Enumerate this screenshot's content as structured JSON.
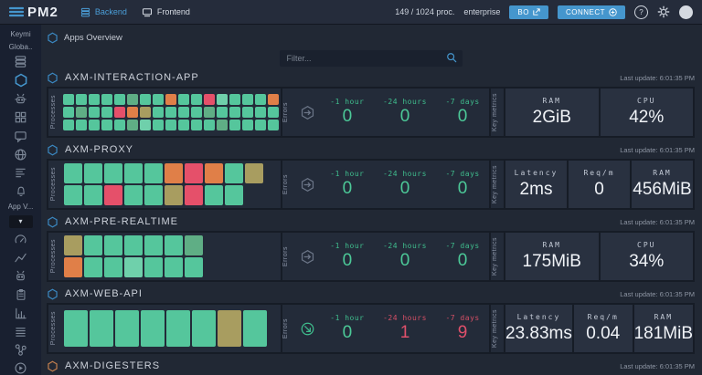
{
  "topbar": {
    "logo_text": "PM2",
    "tabs": [
      {
        "label": "Backend",
        "active": true
      },
      {
        "label": "Frontend",
        "active": false
      }
    ],
    "processes_count": "149 / 1024 proc.",
    "plan": "enterprise",
    "bo_button_label": "BO",
    "connect_button_label": "CONNECT",
    "accent_blue": "#4596cd"
  },
  "sidebar": {
    "keymetrics_label": "Keymi",
    "global_label": "Globa..",
    "app_label": "App V...",
    "icons": [
      "servers-icon",
      "hexagon-apps-icon",
      "robot-icon",
      "modules-grid-icon",
      "chat-icon",
      "globe-icon",
      "metrics-bars-icon",
      "bell-icon",
      "dashboard-gauge-icon",
      "line-chart-icon",
      "robot-profiling-icon",
      "report-clipboard-icon",
      "histogram-icon",
      "logs-list-icon",
      "dependencies-icon",
      "play-circle-icon"
    ]
  },
  "page": {
    "title": "Apps Overview",
    "filter_placeholder": "Filter..."
  },
  "labels": {
    "processes": "Processes",
    "errors": "Errors",
    "key_metrics": "Key metrics"
  },
  "colors": {
    "g": "#55c69c",
    "G": "#6fd0ab",
    "d": "#5fae85",
    "k": "#a89d60",
    "o": "#e07f48",
    "r": "#e5506a",
    "ok_green": "#45c392",
    "alert_red": "#d94f63",
    "hex_blue": "#3a87c0",
    "hex_orange": "#bf7e4e"
  },
  "apps": [
    {
      "name": "AXM-INTERACTION-APP",
      "last_update": "Last update: 6:01:35 PM",
      "hex_color": "#3a87c0",
      "errors_icon": "hexagon-arrow",
      "grid": {
        "cw": 12,
        "ch": 12,
        "rows": [
          "gggggdggoggrGgggo",
          "gdggrokggggdggggg",
          "gggggdGgggggdgggg"
        ]
      },
      "errors": [
        {
          "label": "-1 hour",
          "value": "0",
          "alert": false
        },
        {
          "label": "-24 hours",
          "value": "0",
          "alert": false
        },
        {
          "label": "-7 days",
          "value": "0",
          "alert": false
        }
      ],
      "metrics": [
        {
          "label": "RAM",
          "value": "2GiB"
        },
        {
          "label": "CPU",
          "value": "42%"
        }
      ]
    },
    {
      "name": "AXM-PROXY",
      "last_update": "Last update: 6:01:35 PM",
      "hex_color": "#3a87c0",
      "errors_icon": "hexagon-arrow",
      "grid": {
        "cw": 20,
        "ch": 22,
        "rows": [
          "gggggorogk",
          "ggrggkrgg"
        ]
      },
      "errors": [
        {
          "label": "-1 hour",
          "value": "0",
          "alert": false
        },
        {
          "label": "-24 hours",
          "value": "0",
          "alert": false
        },
        {
          "label": "-7 days",
          "value": "0",
          "alert": false
        }
      ],
      "metrics": [
        {
          "label": "Latency",
          "value": "2ms"
        },
        {
          "label": "Req/m",
          "value": "0"
        },
        {
          "label": "RAM",
          "value": "456MiB"
        }
      ]
    },
    {
      "name": "AXM-PRE-REALTIME",
      "last_update": "Last update: 6:01:35 PM",
      "hex_color": "#3a87c0",
      "errors_icon": "hexagon-arrow",
      "grid": {
        "cw": 20,
        "ch": 22,
        "rows": [
          "kgggggd",
          "oggGggg"
        ]
      },
      "errors": [
        {
          "label": "-1 hour",
          "value": "0",
          "alert": false
        },
        {
          "label": "-24 hours",
          "value": "0",
          "alert": false
        },
        {
          "label": "-7 days",
          "value": "0",
          "alert": false
        }
      ],
      "metrics": [
        {
          "label": "RAM",
          "value": "175MiB"
        },
        {
          "label": "CPU",
          "value": "34%"
        }
      ]
    },
    {
      "name": "AXM-WEB-API",
      "last_update": "Last update: 6:01:35 PM",
      "hex_color": "#3a87c0",
      "errors_icon": "circle-arrow",
      "grid": {
        "cw": 26,
        "ch": 40,
        "rows": [
          "ggggggkg"
        ]
      },
      "errors": [
        {
          "label": "-1 hour",
          "value": "0",
          "alert": false
        },
        {
          "label": "-24 hours",
          "value": "1",
          "alert": true
        },
        {
          "label": "-7 days",
          "value": "9",
          "alert": true
        }
      ],
      "metrics": [
        {
          "label": "Latency",
          "value": "23.83ms"
        },
        {
          "label": "Req/m",
          "value": "0.04"
        },
        {
          "label": "RAM",
          "value": "181MiB"
        }
      ]
    },
    {
      "name": "AXM-DIGESTERS",
      "last_update": "Last update: 6:01:35 PM",
      "hex_color": "#bf7e4e",
      "header_only": true
    }
  ]
}
